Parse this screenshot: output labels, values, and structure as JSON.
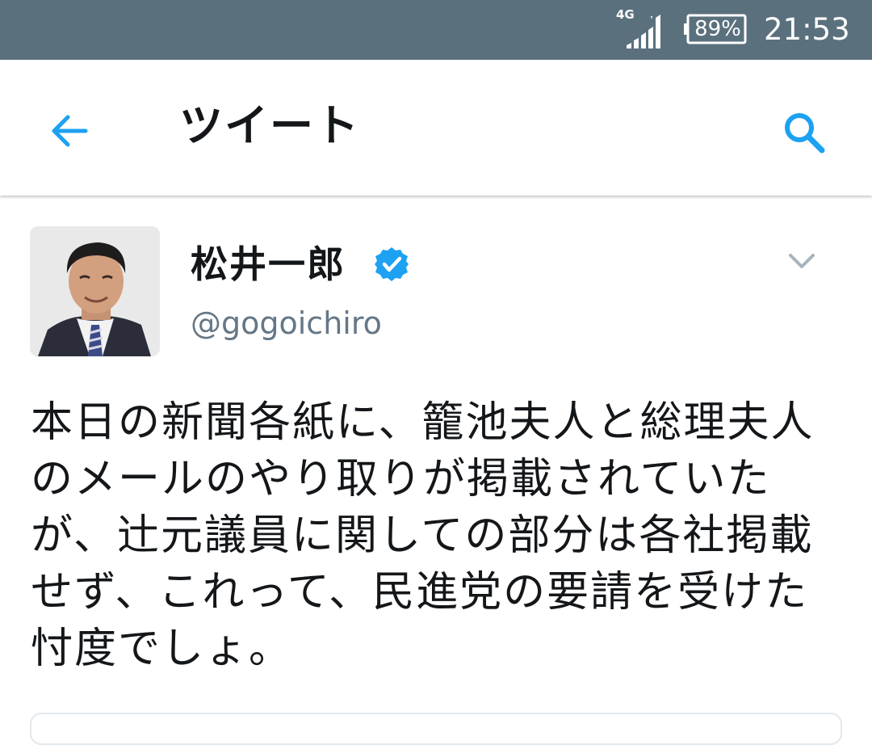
{
  "status_bar": {
    "network": "4G",
    "battery": "89%",
    "time": "21:53"
  },
  "app_bar": {
    "title": "ツイート",
    "back_icon": "arrow-left-icon",
    "search_icon": "search-icon",
    "accent_color": "#1da1f2"
  },
  "tweet": {
    "display_name": "松井一郎",
    "verified": true,
    "handle": "@gogoichiro",
    "text": "本日の新聞各紙に、籠池夫人と総理夫人のメールのやり取りが掲載されていたが、辻元議員に関しての部分は各社掲載せず、これって、民進党の要請を受けた忖度でしょ。"
  },
  "colors": {
    "status_bar": "#5b707d",
    "name": "#14171a",
    "handle": "#657786",
    "verified_badge": "#1da1f2",
    "caret": "#a7b4bd"
  }
}
